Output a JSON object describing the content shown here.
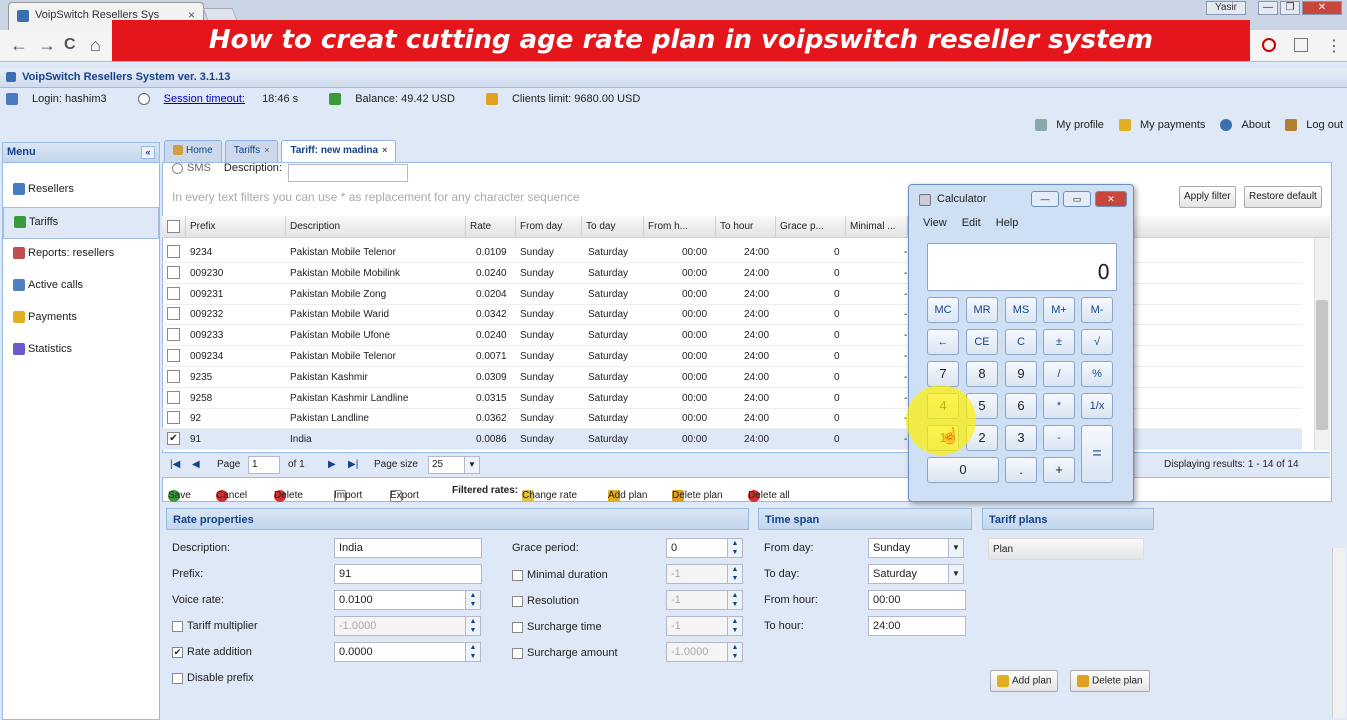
{
  "browser": {
    "tab_title": "VoipSwitch Resellers Sys",
    "tab_close": "×",
    "win_user": "Yasir",
    "win_min": "—",
    "win_max": "❐",
    "win_close": "✕",
    "back": "←",
    "forward": "→",
    "reload": "C",
    "home": "⌂",
    "menu": "⋮"
  },
  "banner": "How to creat cutting age rate plan in voipswitch reseller system",
  "app": {
    "title": "VoipSwitch Resellers System ver. 3.1.13",
    "login": "Login: hashim3",
    "session_label": "Session timeout:",
    "session_value": "18:46 s",
    "balance": "Balance: 49.42 USD",
    "clients_limit": "Clients limit: 9680.00 USD",
    "links": [
      "My profile",
      "My payments",
      "About",
      "Log out"
    ]
  },
  "menu": {
    "title": "Menu",
    "collapse": "«",
    "items": [
      "Resellers",
      "Tariffs",
      "Reports: resellers",
      "Active calls",
      "Payments",
      "Statistics"
    ]
  },
  "tabs": [
    "Home",
    "Tariffs",
    "Tariff: new madina"
  ],
  "tab_close": "×",
  "filters": {
    "sms": "SMS",
    "description_label": "Description:",
    "hint": "In every text filters you can use * as replacement for any character sequence",
    "apply": "Apply filter",
    "restore": "Restore default"
  },
  "grid": {
    "columns": [
      "Prefix",
      "Description",
      "Rate",
      "From day",
      "To day",
      "From h...",
      "To hour",
      "Grace p...",
      "Minimal ..."
    ],
    "rows": [
      {
        "prefix": "9234",
        "description": "Pakistan Mobile Telenor",
        "rate": "0.0109",
        "from_day": "Sunday",
        "to_day": "Saturday",
        "from_hour": "00:00",
        "to_hour": "24:00",
        "grace": "0",
        "checked": false
      },
      {
        "prefix": "009230",
        "description": "Pakistan Mobile Mobilink",
        "rate": "0.0240",
        "from_day": "Sunday",
        "to_day": "Saturday",
        "from_hour": "00:00",
        "to_hour": "24:00",
        "grace": "0",
        "checked": false
      },
      {
        "prefix": "009231",
        "description": "Pakistan Mobile Zong",
        "rate": "0.0204",
        "from_day": "Sunday",
        "to_day": "Saturday",
        "from_hour": "00:00",
        "to_hour": "24:00",
        "grace": "0",
        "checked": false
      },
      {
        "prefix": "009232",
        "description": "Pakistan Mobile Warid",
        "rate": "0.0342",
        "from_day": "Sunday",
        "to_day": "Saturday",
        "from_hour": "00:00",
        "to_hour": "24:00",
        "grace": "0",
        "checked": false
      },
      {
        "prefix": "009233",
        "description": "Pakistan Mobile Ufone",
        "rate": "0.0240",
        "from_day": "Sunday",
        "to_day": "Saturday",
        "from_hour": "00:00",
        "to_hour": "24:00",
        "grace": "0",
        "checked": false
      },
      {
        "prefix": "009234",
        "description": "Pakistan Mobile Telenor",
        "rate": "0.0071",
        "from_day": "Sunday",
        "to_day": "Saturday",
        "from_hour": "00:00",
        "to_hour": "24:00",
        "grace": "0",
        "checked": false
      },
      {
        "prefix": "9235",
        "description": "Pakistan Kashmir",
        "rate": "0.0309",
        "from_day": "Sunday",
        "to_day": "Saturday",
        "from_hour": "00:00",
        "to_hour": "24:00",
        "grace": "0",
        "checked": false
      },
      {
        "prefix": "9258",
        "description": "Pakistan Kashmir Landline",
        "rate": "0.0315",
        "from_day": "Sunday",
        "to_day": "Saturday",
        "from_hour": "00:00",
        "to_hour": "24:00",
        "grace": "0",
        "checked": false
      },
      {
        "prefix": "92",
        "description": "Pakistan Landline",
        "rate": "0.0362",
        "from_day": "Sunday",
        "to_day": "Saturday",
        "from_hour": "00:00",
        "to_hour": "24:00",
        "grace": "0",
        "checked": false
      },
      {
        "prefix": "91",
        "description": "India",
        "rate": "0.0086",
        "from_day": "Sunday",
        "to_day": "Saturday",
        "from_hour": "00:00",
        "to_hour": "24:00",
        "grace": "0",
        "checked": true
      }
    ]
  },
  "pager": {
    "page_label": "Page",
    "page_value": "1",
    "of_label": "of 1",
    "page_size_label": "Page size",
    "page_size_value": "25",
    "display": "Displaying results: 1 - 14 of 14"
  },
  "actions": {
    "save": "Save",
    "cancel": "Cancel",
    "delete": "Delete",
    "import": "Import",
    "export": "Export",
    "filtered": "Filtered rates:",
    "change_rate": "Change rate",
    "add_plan": "Add plan",
    "delete_plan": "Delete plan",
    "delete_all": "Delete all"
  },
  "rate_props": {
    "title": "Rate properties",
    "description_label": "Description:",
    "description_value": "India",
    "prefix_label": "Prefix:",
    "prefix_value": "91",
    "voice_rate_label": "Voice rate:",
    "voice_rate_value": "0.0100",
    "tariff_mult_label": "Tariff multiplier",
    "tariff_mult_value": "-1.0000",
    "rate_add_label": "Rate addition",
    "rate_add_value": "0.0000",
    "disable_prefix_label": "Disable prefix",
    "grace_label": "Grace period:",
    "grace_value": "0",
    "min_dur_label": "Minimal duration",
    "min_dur_value": "-1",
    "resolution_label": "Resolution",
    "resolution_value": "-1",
    "sur_time_label": "Surcharge time",
    "sur_time_value": "-1",
    "sur_amount_label": "Surcharge amount",
    "sur_amount_value": "-1.0000"
  },
  "time_span": {
    "title": "Time span",
    "from_day_label": "From day:",
    "from_day_value": "Sunday",
    "to_day_label": "To day:",
    "to_day_value": "Saturday",
    "from_hour_label": "From hour:",
    "from_hour_value": "00:00",
    "to_hour_label": "To hour:",
    "to_hour_value": "24:00"
  },
  "tariff_plans": {
    "title": "Tariff plans",
    "col": "Plan",
    "add": "Add plan",
    "delete": "Delete plan"
  },
  "calculator": {
    "title": "Calculator",
    "menu": [
      "View",
      "Edit",
      "Help"
    ],
    "display": "0",
    "keys": [
      [
        "MC",
        "MR",
        "MS",
        "M+",
        "M-"
      ],
      [
        "←",
        "CE",
        "C",
        "±",
        "√"
      ],
      [
        "7",
        "8",
        "9",
        "/",
        "%"
      ],
      [
        "4",
        "5",
        "6",
        "*",
        "1/x"
      ],
      [
        "1",
        "2",
        "3",
        "-"
      ]
    ],
    "equals": "=",
    "zero": "0",
    "dot": ".",
    "plus": "+"
  },
  "colors": {
    "banner": "#e4151b",
    "header_text": "#15428b",
    "panel_border": "#99bbe8",
    "highlight": "#fff000"
  }
}
